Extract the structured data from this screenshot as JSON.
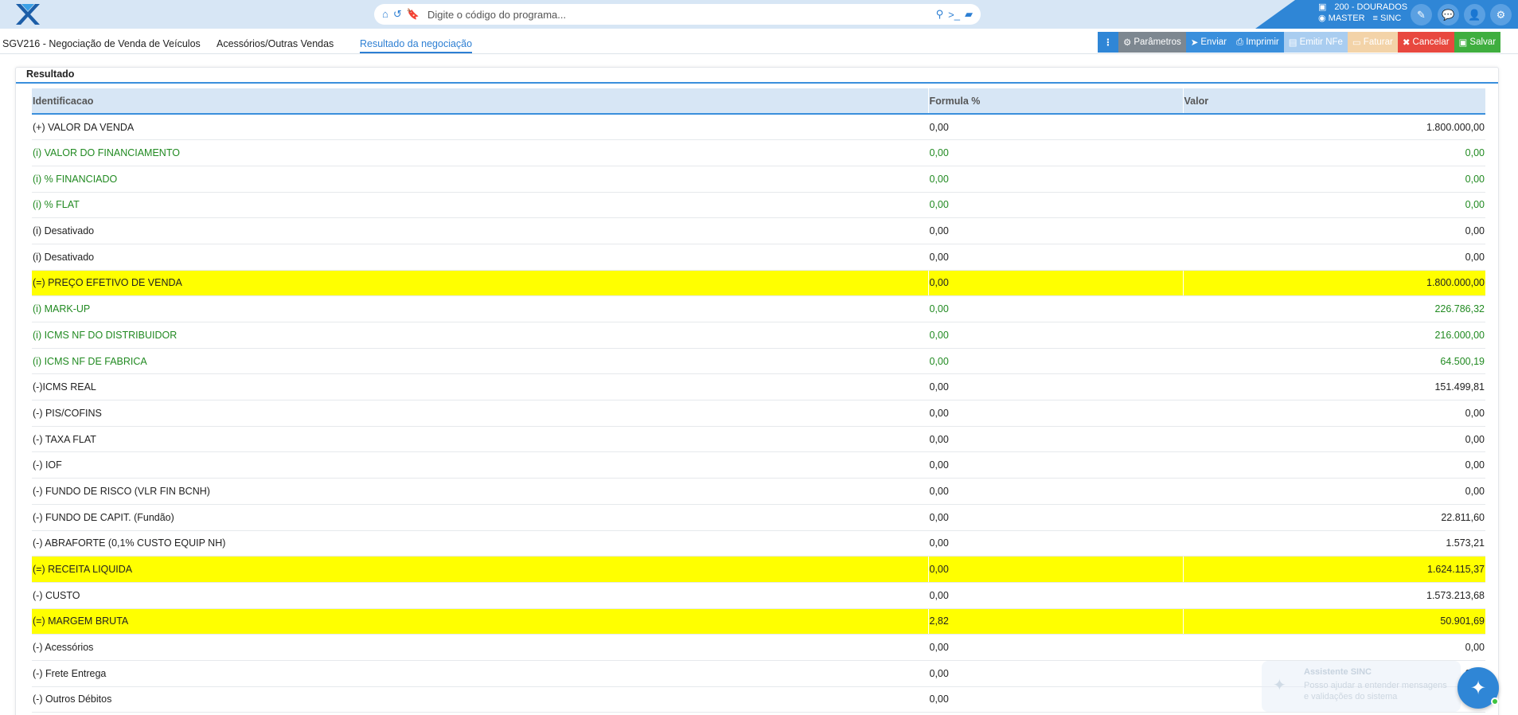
{
  "search": {
    "placeholder": "Digite o código do programa..."
  },
  "user": {
    "branch": "200 - DOURADOS",
    "user_name": "MASTER",
    "system": "SINC"
  },
  "tabs": [
    {
      "label": "SGV216 - Negociação de Venda de Veículos"
    },
    {
      "label": "Acessórios/Outras Vendas"
    },
    {
      "label": "Resultado da negociação"
    }
  ],
  "actions": {
    "more": "⋮",
    "parametros": "Parâmetros",
    "enviar": "Enviar",
    "imprimir": "Imprimir",
    "emitir_nfe": "Emitir NFe",
    "faturar": "Faturar",
    "cancelar": "Cancelar",
    "salvar": "Salvar"
  },
  "card": {
    "title": "Resultado"
  },
  "table": {
    "headers": [
      "Identificacao",
      "Formula %",
      "Valor"
    ],
    "rows": [
      {
        "id": "(+) VALOR DA VENDA",
        "formula": "0,00",
        "valor": "1.800.000,00",
        "style": "normal"
      },
      {
        "id": "(i) VALOR DO FINANCIAMENTO",
        "formula": "0,00",
        "valor": "0,00",
        "style": "green"
      },
      {
        "id": "(i) % FINANCIADO",
        "formula": "0,00",
        "valor": "0,00",
        "style": "green"
      },
      {
        "id": "(i) % FLAT",
        "formula": "0,00",
        "valor": "0,00",
        "style": "green"
      },
      {
        "id": "(i) Desativado",
        "formula": "0,00",
        "valor": "0,00",
        "style": "normal"
      },
      {
        "id": "(i) Desativado",
        "formula": "0,00",
        "valor": "0,00",
        "style": "normal"
      },
      {
        "id": "(=) PREÇO EFETIVO DE VENDA",
        "formula": "0,00",
        "valor": "1.800.000,00",
        "style": "yellow"
      },
      {
        "id": "(i) MARK-UP",
        "formula": "0,00",
        "valor": "226.786,32",
        "style": "green"
      },
      {
        "id": "(i) ICMS NF DO DISTRIBUIDOR",
        "formula": "0,00",
        "valor": "216.000,00",
        "style": "green"
      },
      {
        "id": "(i) ICMS NF DE FABRICA",
        "formula": "0,00",
        "valor": "64.500,19",
        "style": "green"
      },
      {
        "id": "(-)ICMS REAL",
        "formula": "0,00",
        "valor": "151.499,81",
        "style": "normal"
      },
      {
        "id": "(-) PIS/COFINS",
        "formula": "0,00",
        "valor": "0,00",
        "style": "normal"
      },
      {
        "id": "(-) TAXA FLAT",
        "formula": "0,00",
        "valor": "0,00",
        "style": "normal"
      },
      {
        "id": "(-) IOF",
        "formula": "0,00",
        "valor": "0,00",
        "style": "normal"
      },
      {
        "id": "(-) FUNDO DE RISCO (VLR FIN BCNH)",
        "formula": "0,00",
        "valor": "0,00",
        "style": "normal"
      },
      {
        "id": "(-) FUNDO DE CAPIT. (Fundão)",
        "formula": "0,00",
        "valor": "22.811,60",
        "style": "normal"
      },
      {
        "id": "(-) ABRAFORTE (0,1% CUSTO EQUIP NH)",
        "formula": "0,00",
        "valor": "1.573,21",
        "style": "normal"
      },
      {
        "id": "(=) RECEITA LIQUIDA",
        "formula": "0,00",
        "valor": "1.624.115,37",
        "style": "yellow"
      },
      {
        "id": "(-) CUSTO",
        "formula": "0,00",
        "valor": "1.573.213,68",
        "style": "normal"
      },
      {
        "id": "(=) MARGEM BRUTA",
        "formula": "2,82",
        "valor": "50.901,69",
        "style": "yellow"
      },
      {
        "id": "(-) Acessórios",
        "formula": "0,00",
        "valor": "0,00",
        "style": "normal"
      },
      {
        "id": "(-) Frete Entrega",
        "formula": "0,00",
        "valor": "0,00",
        "style": "normal"
      },
      {
        "id": "(-) Outros Débitos",
        "formula": "0,00",
        "valor": "",
        "style": "normal"
      }
    ]
  },
  "assistant": {
    "title": "Assistente SINC",
    "line1": "Posso ajudar a entender mensagens",
    "line2": "e validações do sistema"
  },
  "colors": {
    "accent": "#2f86d6",
    "highlight": "#ffff00",
    "positive_info": "#218a21"
  }
}
